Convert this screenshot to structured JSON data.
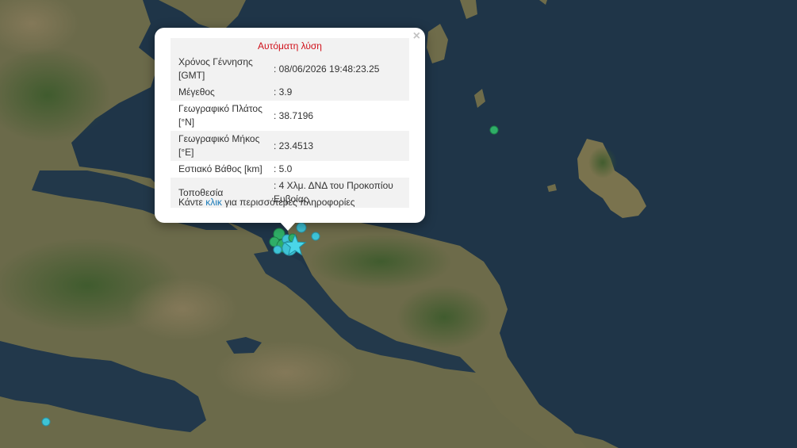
{
  "popup": {
    "title": "Αυτόματη λύση",
    "close": "×",
    "rows": [
      {
        "label": "Χρόνος Γέννησης [GMT]",
        "value": ": 08/06/2026 19:48:23.25"
      },
      {
        "label": "Μέγεθος",
        "value": ": 3.9"
      },
      {
        "label": "Γεωγραφικό Πλάτος [°N]",
        "value": ": 38.7196"
      },
      {
        "label": "Γεωγραφικό Μήκος [°E]",
        "value": ": 23.4513"
      },
      {
        "label": "Εστιακό Βάθος [km]",
        "value": ": 5.0"
      },
      {
        "label": "Τοποθεσία",
        "value": ": 4 Χλμ. ΔΝΔ του Προκοπίου Ευβοίας"
      }
    ],
    "more_prefix": "Κάντε ",
    "more_link": "κλικ",
    "more_suffix": " για περισσότερες πληροφορίες"
  },
  "colors": {
    "sea": "#1d3347",
    "land": "#6a6a4a",
    "vegetation": "#3f5a2e",
    "star": "#4ad6e8",
    "quake_cyan": "#3ec3d6",
    "quake_green": "#2fae67",
    "title_red": "#d0101a",
    "link_blue": "#1a7bb9"
  }
}
